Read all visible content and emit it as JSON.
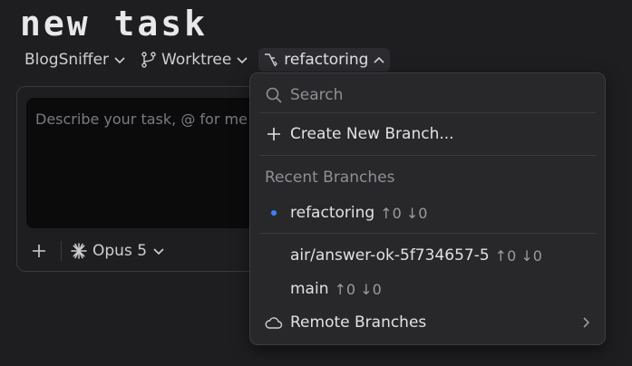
{
  "title": "new task",
  "toolbar": {
    "project": "BlogSniffer",
    "mode": "Worktree",
    "branch": "refactoring"
  },
  "composer": {
    "placeholder": "Describe your task, @ for me",
    "model": "Opus 5"
  },
  "dropdown": {
    "search_placeholder": "Search",
    "create_label": "Create New Branch...",
    "recent_header": "Recent Branches",
    "current": {
      "name": "refactoring",
      "counts": "↑0 ↓0"
    },
    "others": [
      {
        "name": "air/answer-ok-5f734657-5",
        "counts": "↑0 ↓0"
      },
      {
        "name": "main",
        "counts": "↑0 ↓0"
      }
    ],
    "remote_label": "Remote Branches"
  },
  "colors": {
    "accent": "#3b82f6",
    "background": "#1e1e20",
    "menu": "#28282b"
  },
  "icons": [
    "branch-icon",
    "git-branch-icon",
    "search-icon",
    "plus-icon",
    "cloud-icon",
    "chevron-right-icon",
    "sparkle-icon",
    "chevron-down-icon",
    "chevron-up-icon"
  ]
}
